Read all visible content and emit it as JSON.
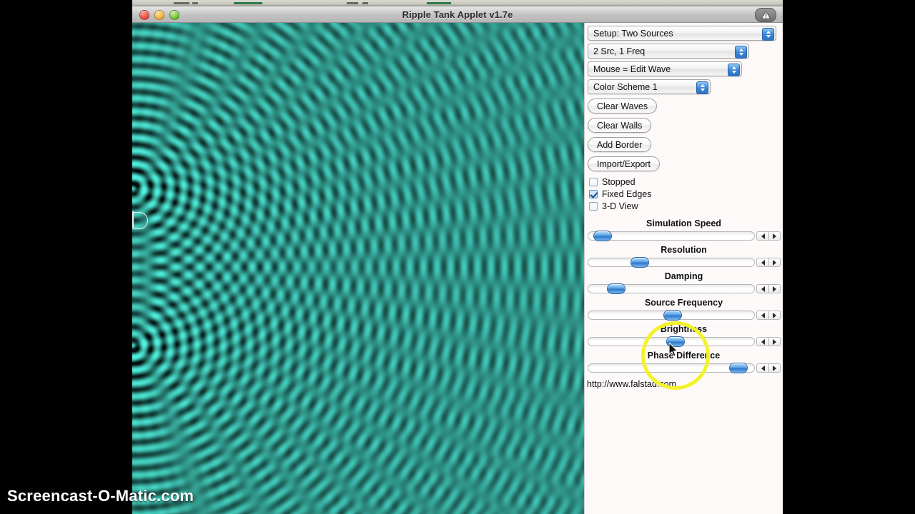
{
  "window": {
    "title": "Ripple Tank Applet v1.7e",
    "traffic_lights": [
      "close",
      "minimize",
      "zoom"
    ],
    "alert_icon": "warning-triangle-icon"
  },
  "simulation": {
    "label": "ripple-tank-canvas",
    "source_marker": "wave-source-marker",
    "colors": {
      "background": "#04100f",
      "wave_bright": "#4ff0dd",
      "wave_mid": "#1f8f86",
      "wave_dark": "#020c0b"
    },
    "sources": 2,
    "source_positions": [
      [
        0.0,
        0.335
      ],
      [
        0.0,
        0.655
      ]
    ]
  },
  "panel": {
    "popups": [
      {
        "name": "setup-popup",
        "label": "Setup: Two Sources"
      },
      {
        "name": "source-mode-popup",
        "label": "2 Src, 1 Freq"
      },
      {
        "name": "mouse-mode-popup",
        "label": "Mouse = Edit Wave"
      },
      {
        "name": "color-scheme-popup",
        "label": "Color Scheme 1"
      }
    ],
    "buttons": [
      {
        "name": "clear-waves-button",
        "label": "Clear Waves"
      },
      {
        "name": "clear-walls-button",
        "label": "Clear Walls"
      },
      {
        "name": "add-border-button",
        "label": "Add Border"
      },
      {
        "name": "import-export-button",
        "label": "Import/Export"
      }
    ],
    "checkboxes": [
      {
        "name": "stopped-checkbox",
        "label": "Stopped",
        "checked": false
      },
      {
        "name": "fixed-edges-checkbox",
        "label": "Fixed Edges",
        "checked": true
      },
      {
        "name": "3d-view-checkbox",
        "label": "3-D View",
        "checked": false
      }
    ],
    "sliders": [
      {
        "name": "simulation-speed-slider",
        "label": "Simulation Speed",
        "value_pct": 4
      },
      {
        "name": "resolution-slider",
        "label": "Resolution",
        "value_pct": 29
      },
      {
        "name": "damping-slider",
        "label": "Damping",
        "value_pct": 13
      },
      {
        "name": "source-frequency-slider",
        "label": "Source Frequency",
        "value_pct": 51
      },
      {
        "name": "brightness-slider",
        "label": "Brightness",
        "value_pct": 53
      },
      {
        "name": "phase-difference-slider",
        "label": "Phase Difference",
        "value_pct": 95
      }
    ],
    "url": "http://www.falstad.com"
  },
  "overlay": {
    "focus_ring_color": "#f3f32a",
    "cursor": "arrow-pointer",
    "watermark": "Screencast-O-Matic.com"
  }
}
